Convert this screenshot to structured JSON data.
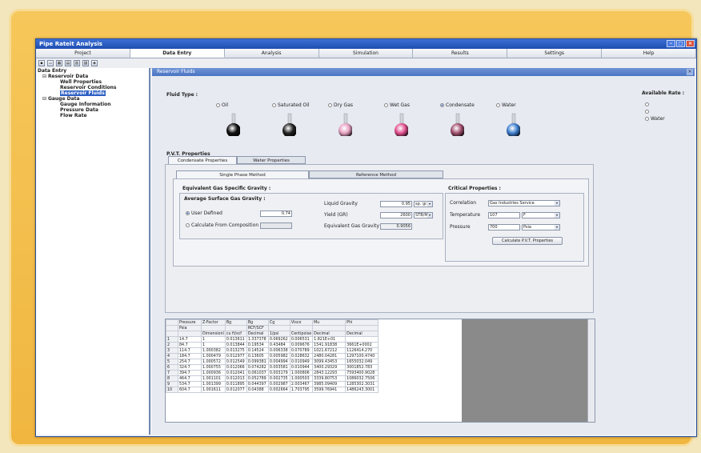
{
  "window": {
    "title": "Pipe Rateit Analysis"
  },
  "menu": [
    "Project",
    "Data Entry",
    "Analysis",
    "Simulation",
    "Results",
    "Settings",
    "Help"
  ],
  "active_menu": 1,
  "tree": {
    "root": "Data Entry",
    "items": [
      {
        "label": "Reservoir Data",
        "level": 1,
        "toggle": "-"
      },
      {
        "label": "Well Properties",
        "level": 2
      },
      {
        "label": "Reservoir Conditions",
        "level": 2
      },
      {
        "label": "Reservoir Fluids",
        "level": 2,
        "selected": true
      },
      {
        "label": "Gauge Data",
        "level": 1,
        "toggle": "-"
      },
      {
        "label": "Gauge Information",
        "level": 2
      },
      {
        "label": "Pressure Data",
        "level": 2
      },
      {
        "label": "Flow Rate",
        "level": 2
      }
    ]
  },
  "panel": {
    "title": "Reservoir Fluids"
  },
  "fluid": {
    "label": "Fluid Type :",
    "types": [
      {
        "name": "Oil",
        "color": "#111111",
        "selected": false
      },
      {
        "name": "Saturated Oil",
        "color": "#222222",
        "selected": false
      },
      {
        "name": "Dry Gas",
        "color": "#e7a1c2",
        "selected": false
      },
      {
        "name": "Wet Gas",
        "color": "#e2508f",
        "selected": false
      },
      {
        "name": "Condensate",
        "color": "#a1506f",
        "selected": true
      },
      {
        "name": "Water",
        "color": "#3f7fd0",
        "selected": false
      }
    ]
  },
  "available": {
    "label": "Available Rate :",
    "options": [
      "",
      "",
      "Water"
    ]
  },
  "pvt": {
    "label": "P.V.T. Properties",
    "tabs": [
      "Condensate Properties",
      "Water Properties"
    ],
    "subtabs": [
      "Single Phase Method",
      "Reference Method"
    ],
    "equiv_title": "Equivalent Gas Specific Gravity :",
    "avg_title": "Average Surface Gas Gravity :",
    "user_defined": "User Defined",
    "user_value": "0.74",
    "calc_comp": "Calculate From Composition",
    "liquid_gravity_label": "Liquid Gravity",
    "liquid_gravity_value": "0.95",
    "liquid_gravity_unit": "sp. gr.",
    "yield_label": "Yield (GR)",
    "yield_value": "2600",
    "yield_unit": "STB/M",
    "equiv_gravity_label": "Equivalent Gas Gravity",
    "equiv_gravity_value": "0.9056",
    "crit_title": "Critical Properties :",
    "correlation_label": "Correlation",
    "correlation_value": "Gas Industries Service",
    "temperature_label": "Temperature",
    "temperature_value": "107",
    "temperature_unit": "F",
    "pressure_label": "Pressure",
    "pressure_value": "700",
    "pressure_unit": "Psia",
    "calc_button": "Calculate P.V.T. Properties"
  },
  "grid": {
    "headers1": [
      "",
      "Pressure",
      "Z-Factor",
      "Bg",
      "Bg",
      "Cg",
      "Visco",
      "Mu",
      "Phi"
    ],
    "headers2": [
      "",
      "Psia",
      "",
      "",
      "RCF/SCF",
      "",
      "",
      "",
      ""
    ],
    "headers3": [
      "",
      "",
      "Dimensionl",
      "cu ft/scf",
      "Decimal",
      "1/psi",
      "Centipoise",
      "Decimal",
      "Decimal"
    ],
    "rows": [
      [
        "1",
        "14.7",
        "1",
        "0.013611",
        "1.337378",
        "0.069262",
        "0.006531",
        "1.821E+01",
        ""
      ],
      [
        "2",
        "84.7",
        "1",
        "0.013844",
        "0.19534",
        "0.43484",
        "0.009676",
        "1541.91838",
        "3661E+0002"
      ],
      [
        "3",
        "114.7",
        "1.000382",
        "0.013275",
        "0.14524",
        "0.006338",
        "0.070789",
        "1021.67212",
        "1126414.270"
      ],
      [
        "4",
        "184.7",
        "1.000479",
        "0.012977",
        "0.13605",
        "0.005982",
        "0.028632",
        "2480.04281",
        "1297100.4740"
      ],
      [
        "5",
        "254.7",
        "1.000572",
        "0.012549",
        "0.099381",
        "0.004994",
        "0.010949",
        "3099.43453",
        "1655032.049"
      ],
      [
        "6",
        "324.7",
        "1.000755",
        "0.012066",
        "0.074282",
        "0.003581",
        "0.010944",
        "3400.29329",
        "3001852.783"
      ],
      [
        "7",
        "394.7",
        "1.000936",
        "0.012041",
        "0.061037",
        "0.003179",
        "1.000806",
        "2843.12293",
        "7593400.9028"
      ],
      [
        "8",
        "464.7",
        "1.001101",
        "0.012013",
        "0.052789",
        "0.002735",
        "1.000503",
        "3339.80753",
        "1086032.7506"
      ],
      [
        "9",
        "534.7",
        "1.001399",
        "0.011895",
        "0.044397",
        "0.002987",
        "2.003467",
        "3985.09409",
        "1285302.3031"
      ],
      [
        "10",
        "604.7",
        "1.001611",
        "0.012077",
        "0.04388",
        "0.002664",
        "1.703795",
        "3599.76941",
        "1486243.3001"
      ]
    ]
  }
}
